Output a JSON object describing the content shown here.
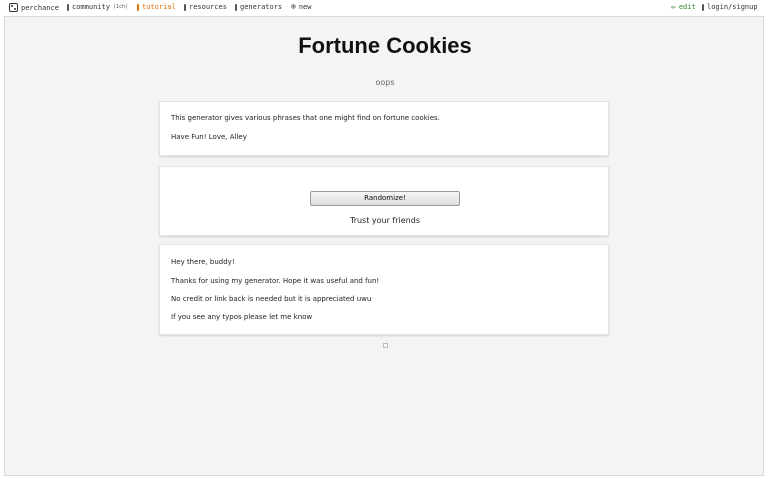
{
  "nav": {
    "brand": "perchance",
    "community": "community",
    "community_count": "(1ch)",
    "tutorial": "tutorial",
    "resources": "resources",
    "generators": "generators",
    "new": "new",
    "edit": "edit",
    "login": "login/signup",
    "new_icon": "⊕",
    "edit_icon": "✏"
  },
  "page": {
    "title": "Fortune Cookies",
    "subtitle": "oops"
  },
  "intro": {
    "line1": "This generator gives various phrases that one might find on fortune cookies.",
    "line2": "Have Fun! Love, Alley"
  },
  "generator": {
    "button_label": "Randomize!",
    "output": "Trust your friends"
  },
  "notes": {
    "line1": "Hey there, buddy!",
    "line2": "Thanks for using my generator. Hope it was useful and fun!",
    "line3": "No credit or link back is needed but it is appreciated uwu",
    "line4": "If you see any typos please let me know"
  },
  "colors": {
    "tutorial": "#e07000",
    "edit": "#2a8a2a",
    "background": "#f4f4f4"
  }
}
